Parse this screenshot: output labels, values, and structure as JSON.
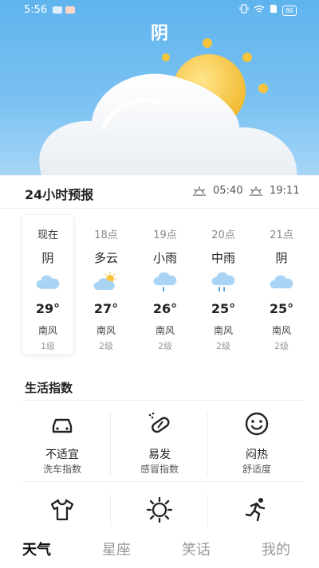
{
  "status_bar": {
    "time": "5:56",
    "battery": "86"
  },
  "header": {
    "condition": "阴"
  },
  "forecast": {
    "title": "24小时预报",
    "sunrise": "05:40",
    "sunset": "19:11",
    "hours": [
      {
        "hour": "现在",
        "condition": "阴",
        "icon": "cloudy-icon",
        "temp": "29°",
        "wind": "南风",
        "level": "1级",
        "active": true
      },
      {
        "hour": "18点",
        "condition": "多云",
        "icon": "partly-cloudy-icon",
        "temp": "27°",
        "wind": "南风",
        "level": "2级"
      },
      {
        "hour": "19点",
        "condition": "小雨",
        "icon": "light-rain-icon",
        "temp": "26°",
        "wind": "南风",
        "level": "2级"
      },
      {
        "hour": "20点",
        "condition": "中雨",
        "icon": "moderate-rain-icon",
        "temp": "25°",
        "wind": "南风",
        "level": "2级"
      },
      {
        "hour": "21点",
        "condition": "阴",
        "icon": "cloudy-icon",
        "temp": "25°",
        "wind": "南风",
        "level": "2级"
      }
    ]
  },
  "life": {
    "title": "生活指数",
    "items": [
      {
        "value": "不适宜",
        "name": "洗车指数",
        "icon": "car-icon"
      },
      {
        "value": "易发",
        "name": "感冒指数",
        "icon": "pill-icon"
      },
      {
        "value": "闷热",
        "name": "舒适度",
        "icon": "smiley-icon"
      },
      {
        "icon": "tshirt-icon"
      },
      {
        "icon": "sun-icon"
      },
      {
        "icon": "running-icon"
      }
    ]
  },
  "nav": {
    "items": [
      {
        "label": "天气",
        "active": true
      },
      {
        "label": "星座"
      },
      {
        "label": "笑话"
      },
      {
        "label": "我的"
      }
    ]
  },
  "colors": {
    "sky": "#5fb4ee",
    "sun": "#f7c940",
    "accent": "#111111"
  }
}
